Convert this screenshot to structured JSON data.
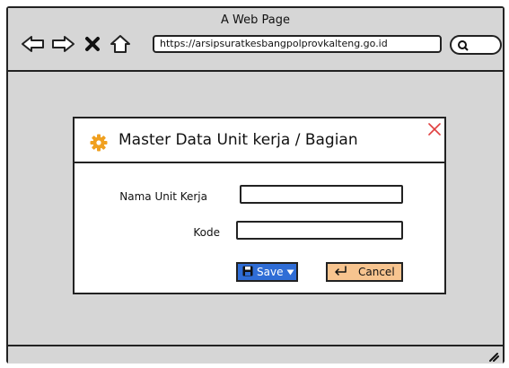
{
  "window": {
    "title": "A Web Page",
    "url": "https://arsipsuratkesbangpolprovkalteng.go.id"
  },
  "toolbar_icons": [
    "back-arrow-icon",
    "forward-arrow-icon",
    "stop-icon",
    "home-icon",
    "search-icon"
  ],
  "dialog": {
    "title": "Master Data Unit kerja / Bagian",
    "fields": [
      {
        "label": "Nama Unit Kerja",
        "value": ""
      },
      {
        "label": "Kode",
        "value": ""
      }
    ],
    "buttons": {
      "save_label": "Save",
      "cancel_label": "Cancel"
    }
  },
  "colors": {
    "save_button": "#2f6dd6",
    "cancel_button": "#f7c48f",
    "gear_icon": "#f0a020",
    "close_icon": "#e04040"
  }
}
